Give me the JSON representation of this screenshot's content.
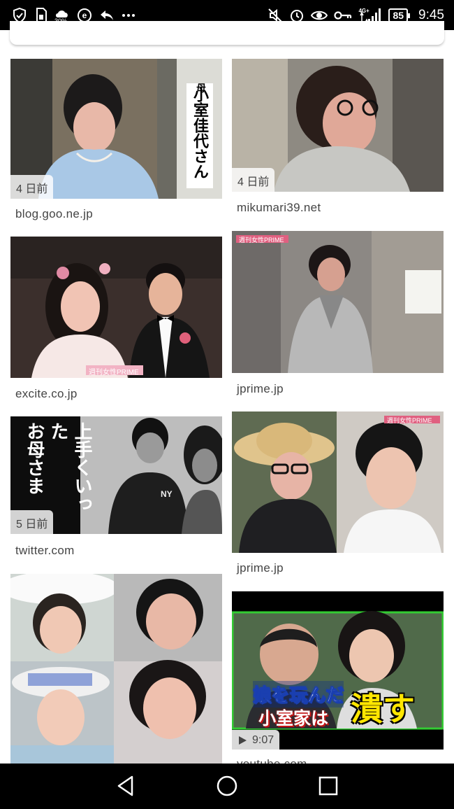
{
  "status_bar": {
    "weather_percent": "30%",
    "battery": "85",
    "time": "9:45",
    "network": "4G+",
    "icons_left": [
      "shield-check-icon",
      "sim-icon",
      "weather-icon",
      "e-app-icon",
      "reply-icon",
      "more-icon"
    ],
    "icons_right": [
      "mute-icon",
      "alarm-icon",
      "eye-icon",
      "key-icon",
      "signal-icon",
      "battery-icon"
    ]
  },
  "results": [
    {
      "source": "blog.goo.ne.jp",
      "age": "4 日前",
      "overlay_text": [
        "母",
        "小室",
        "佳代",
        "さん"
      ]
    },
    {
      "source": "mikumari39.net",
      "age": "4 日前"
    },
    {
      "source": "excite.co.jp",
      "watermark": "週刊女性PRIME"
    },
    {
      "source": "jprime.jp",
      "watermark": "週刊女性PRIME"
    },
    {
      "source": "twitter.com",
      "age": "5 日前",
      "overlay_text": [
        "上手くいった",
        "お母さま"
      ]
    },
    {
      "source": "jprime.jp",
      "watermark": "週刊女性PRIME"
    },
    {
      "source": "",
      "watermark": ""
    },
    {
      "source": "youtube.com",
      "duration": "9:07",
      "overlay_text": [
        "娘を玩んだ",
        "小室家は",
        "潰す"
      ]
    }
  ],
  "nav": {
    "icons": [
      "back-icon",
      "home-icon",
      "recents-icon"
    ]
  },
  "colors": {
    "status_bar": "#000000",
    "nav_bar": "#000000",
    "text": "#444444",
    "video_frame": "#33cc33"
  }
}
